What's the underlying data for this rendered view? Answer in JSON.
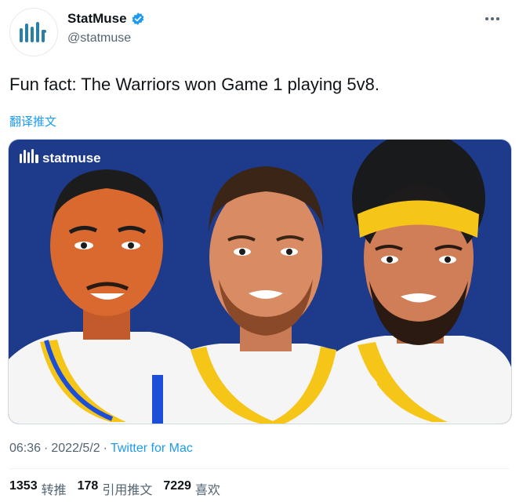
{
  "author": {
    "display_name": "StatMuse",
    "handle": "@statmuse",
    "verified": true,
    "avatar_icon": "statmuse-logo-icon"
  },
  "tweet": {
    "text": "Fun fact: The Warriors won Game 1 playing 5v8.",
    "translate_label": "翻译推文",
    "media": {
      "logo_text": "statmuse",
      "background_color": "#1e3a8a"
    }
  },
  "meta": {
    "time": "06:36",
    "separator1": "·",
    "date": "2022/5/2",
    "separator2": "·",
    "client": "Twitter for Mac"
  },
  "stats": [
    {
      "count": "1353",
      "label": "转推"
    },
    {
      "count": "178",
      "label": "引用推文"
    },
    {
      "count": "7229",
      "label": "喜欢"
    }
  ],
  "colors": {
    "accent": "#1d9bf0",
    "text": "#0f1419",
    "muted": "#536471",
    "logo_teal": "#2a7fa8"
  }
}
